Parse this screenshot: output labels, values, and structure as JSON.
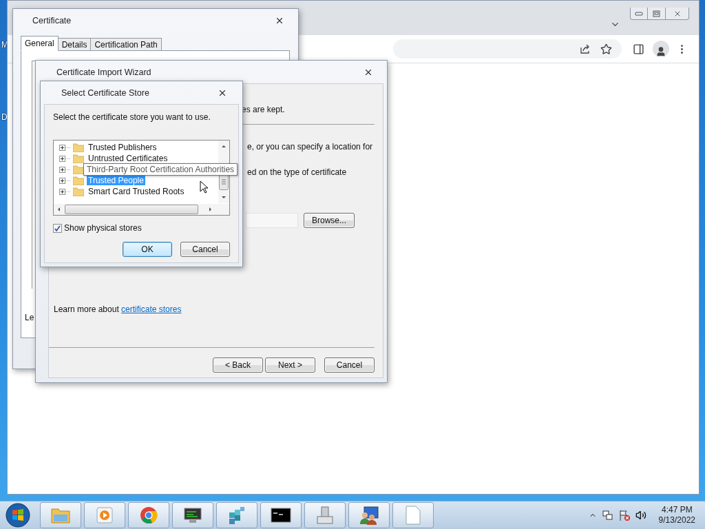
{
  "desktop": {
    "labels": [
      "M",
      "D"
    ]
  },
  "certificate_dialog": {
    "title": "Certificate",
    "tabs": [
      {
        "label": "General",
        "selected": true
      },
      {
        "label": "Details",
        "selected": false
      },
      {
        "label": "Certification Path",
        "selected": false
      }
    ],
    "partial_text": "Le"
  },
  "import_wizard": {
    "title": "Certificate Import Wizard",
    "text_1": "es are kept.",
    "text_2": "e, or you can specify a location for",
    "text_3": "ed on the type of certificate",
    "browse_button": "Browse...",
    "learn_more": {
      "text": "Learn more about",
      "link": "certificate stores"
    },
    "buttons": [
      "< Back",
      "Next >",
      "Cancel"
    ]
  },
  "store_dialog": {
    "title": "Select Certificate Store",
    "instruction": "Select the certificate store you want to use.",
    "tree": [
      {
        "label": "Trusted Publishers",
        "selected": false
      },
      {
        "label": "Untrusted Certificates",
        "selected": false
      },
      {
        "label": "Third-Party Root Certification Authorities",
        "selected": false,
        "tooltip": true
      },
      {
        "label": "Trusted People",
        "selected": true
      },
      {
        "label": "Smart Card Trusted Roots",
        "selected": false
      }
    ],
    "show_physical": {
      "label": "Show physical stores",
      "checked": true
    },
    "buttons": [
      {
        "label": "OK",
        "default": true
      },
      {
        "label": "Cancel",
        "default": false
      }
    ]
  },
  "taskbar": {
    "time": "4:47 PM",
    "date": "9/13/2022"
  }
}
